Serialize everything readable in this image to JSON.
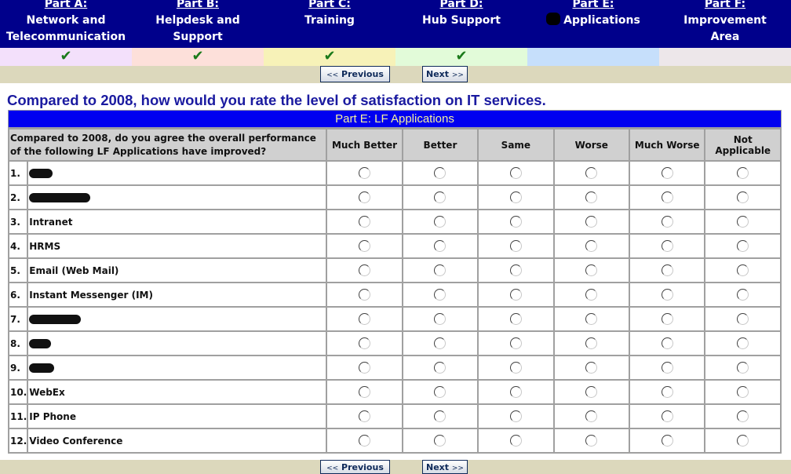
{
  "nav": {
    "parts": [
      {
        "part": "Part A:",
        "title_line1": "Network and",
        "title_line2": "Telecommunication",
        "completed": true,
        "bg": "#f3e0fb",
        "redacted": false
      },
      {
        "part": "Part B:",
        "title_line1": "Helpdesk and",
        "title_line2": "Support",
        "completed": true,
        "bg": "#fde0da",
        "redacted": false
      },
      {
        "part": "Part C:",
        "title_line1": "Training",
        "title_line2": "",
        "completed": true,
        "bg": "#f7f2b8",
        "redacted": false
      },
      {
        "part": "Part D:",
        "title_line1": "Hub Support",
        "title_line2": "",
        "completed": true,
        "bg": "#e2fbd9",
        "redacted": false
      },
      {
        "part": "Part E:",
        "title_line1": "Applications",
        "title_line2": "",
        "completed": false,
        "bg": "#c6dffb",
        "redacted": true
      },
      {
        "part": "Part F:",
        "title_line1": "Improvement",
        "title_line2": "Area",
        "completed": false,
        "bg": "#ede7ea",
        "redacted": false
      }
    ],
    "check_glyph": "✔"
  },
  "buttons": {
    "previous": "Previous",
    "previous_arrows": "<<",
    "next": "Next",
    "next_arrows": ">>"
  },
  "question": "Compared to 2008, how would you rate the level of satisfaction on IT services.",
  "section_title": "Part E: LF Applications",
  "table": {
    "question_header": "Compared to 2008, do you agree the overall performance of the following LF Applications have improved?",
    "options": [
      "Much Better",
      "Better",
      "Same",
      "Worse",
      "Much Worse",
      "Not Applicable"
    ],
    "rows": [
      {
        "num": "1.",
        "label": "",
        "redacted": true
      },
      {
        "num": "2.",
        "label": "",
        "redacted": true
      },
      {
        "num": "3.",
        "label": "Intranet",
        "redacted": false
      },
      {
        "num": "4.",
        "label": "HRMS",
        "redacted": false
      },
      {
        "num": "5.",
        "label": "Email (Web Mail)",
        "redacted": false
      },
      {
        "num": "6.",
        "label": "Instant Messenger (IM)",
        "redacted": false
      },
      {
        "num": "7.",
        "label": "",
        "redacted": true
      },
      {
        "num": "8.",
        "label": "",
        "redacted": true
      },
      {
        "num": "9.",
        "label": "",
        "redacted": true
      },
      {
        "num": "10.",
        "label": "WebEx",
        "redacted": false
      },
      {
        "num": "11.",
        "label": "IP Phone",
        "redacted": false
      },
      {
        "num": "12.",
        "label": "Video Conference",
        "redacted": false
      }
    ]
  },
  "colors": {
    "nav_bg": "#00008b",
    "section_bg": "#0000f0",
    "section_text": "#f4f0a0",
    "question_text": "#1a1aa0",
    "check": "#1a7a1a",
    "button_bar": "#dcd8bc"
  }
}
